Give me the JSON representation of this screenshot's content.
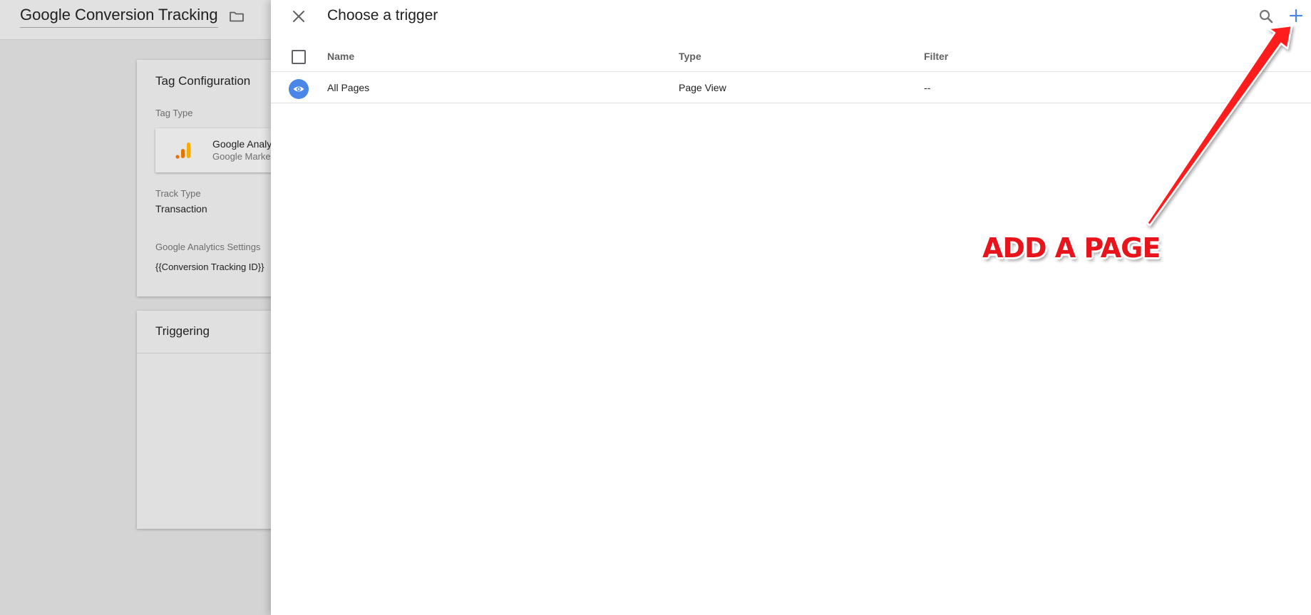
{
  "background": {
    "title": "Google Conversion Tracking",
    "tag_config": {
      "heading": "Tag Configuration",
      "tag_type_label": "Tag Type",
      "tag_type_name": "Google Analy",
      "tag_type_sub": "Google Marke",
      "track_type_label": "Track Type",
      "track_type_value": "Transaction",
      "ga_settings_label": "Google Analytics Settings",
      "ga_settings_value": "{{Conversion Tracking ID}}"
    },
    "triggering": {
      "heading": "Triggering"
    }
  },
  "panel": {
    "title": "Choose a trigger",
    "columns": {
      "name": "Name",
      "type": "Type",
      "filter": "Filter"
    },
    "rows": [
      {
        "name": "All Pages",
        "type": "Page View",
        "filter": "--",
        "icon": "eye-icon"
      }
    ]
  },
  "annotation": {
    "text": "ADD A PAGE"
  },
  "colors": {
    "accent_blue": "#4a86e8",
    "annotation_red": "#e8141b",
    "ga_orange": "#e37400",
    "ga_yellow": "#f9ab00"
  }
}
